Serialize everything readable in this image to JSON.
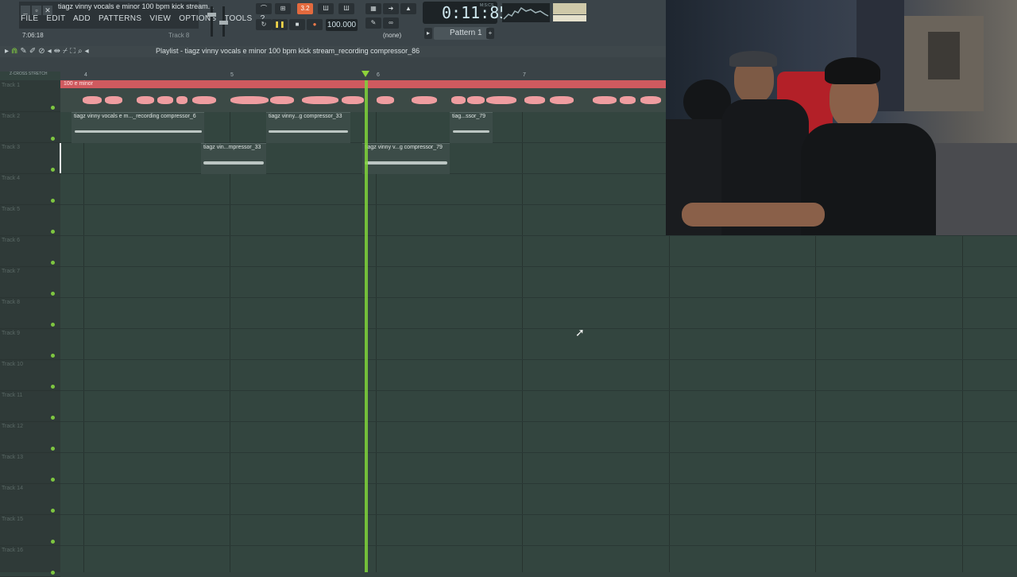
{
  "window": {
    "project_title": "tiagz vinny vocals e minor 100 bpm kick stream...",
    "time_small": "7:06:18",
    "track_hint": "Track 8"
  },
  "menu": [
    "FILE",
    "EDIT",
    "ADD",
    "PATTERNS",
    "VIEW",
    "OPTIONS",
    "TOOLS",
    "?"
  ],
  "transport": {
    "pattern_song_label": "3.2",
    "tempo": "100.000",
    "time": "0:11:85",
    "time_unit": "M:S:CS",
    "pattern": "Pattern 1",
    "none_label": "(none)"
  },
  "playlist": {
    "title": "Playlist - tiagz vinny vocals e minor 100 bpm kick stream_recording compressor_86",
    "snap_labels": "Z-CROSS  STRETCH",
    "bars": [
      "4",
      "5",
      "6",
      "7"
    ],
    "tempo_clip_label": "100 e minor",
    "tracks": [
      "Track 1",
      "Track 2",
      "Track 3",
      "Track 4",
      "Track 5",
      "Track 6",
      "Track 7",
      "Track 8",
      "Track 9",
      "Track 10",
      "Track 11",
      "Track 12",
      "Track 13",
      "Track 14",
      "Track 15",
      "Track 16"
    ],
    "clips": [
      "tiagz vinny vocals e m..._recording compressor_6",
      "tiagz vinny...g compressor_33",
      "tiag...ssor_79",
      "tiagz vin...mpressor_33",
      "tiagz vinny v...g compressor_79"
    ]
  },
  "colors": {
    "accent_playhead": "#7fd33a",
    "tempo_clip": "#cf5a5f",
    "grid_bg": "#33453f"
  },
  "icons": [
    "minimize-icon",
    "maximize-icon",
    "close-icon",
    "play-icon",
    "stop-icon",
    "record-icon",
    "pencil-icon",
    "brush-icon",
    "delete-icon",
    "mute-icon",
    "slice-icon",
    "select-icon",
    "zoom-icon",
    "speaker-icon"
  ]
}
